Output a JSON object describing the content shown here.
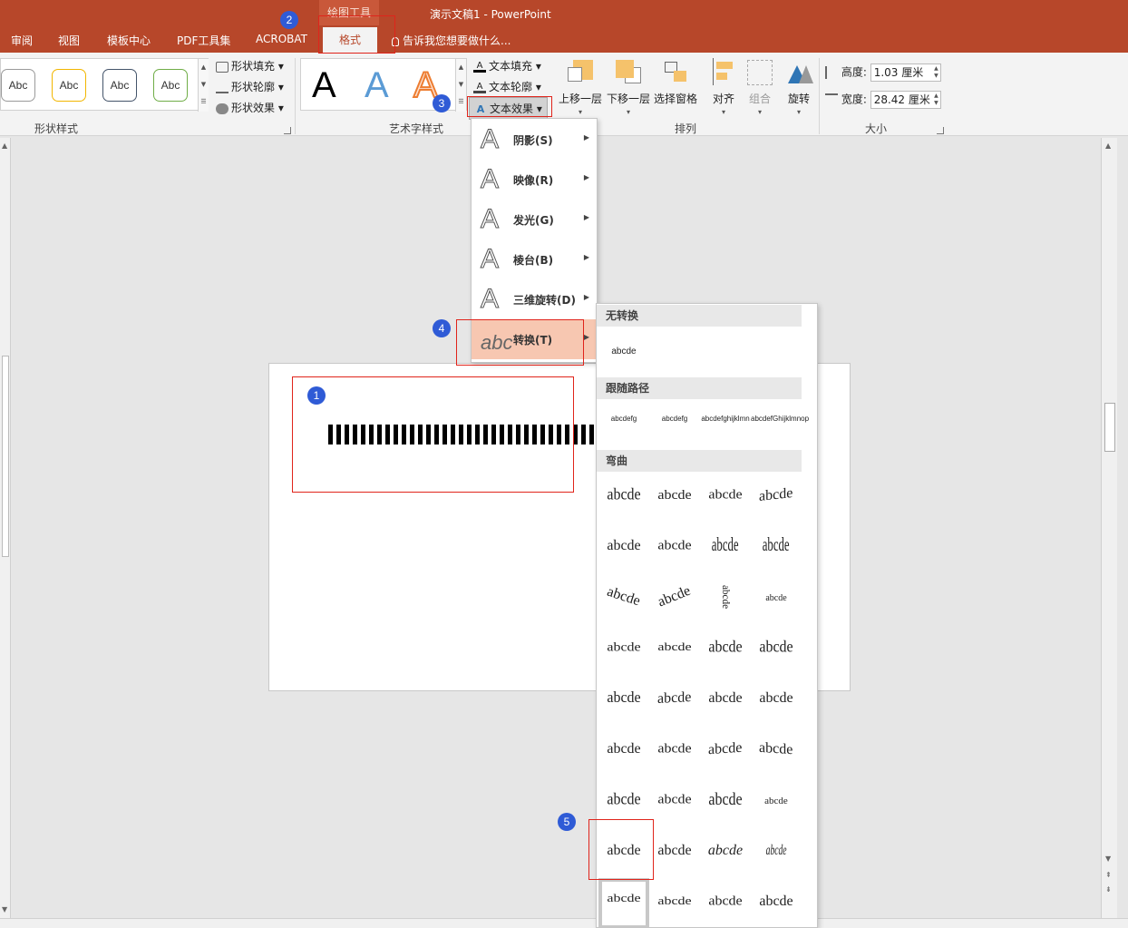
{
  "window": {
    "context_tab_group": "绘图工具",
    "title": "演示文稿1 - PowerPoint"
  },
  "tabs": [
    "审阅",
    "视图",
    "模板中心",
    "PDF工具集",
    "ACROBAT",
    "格式"
  ],
  "active_tab": "格式",
  "tell_me": "告诉我您想要做什么...",
  "ribbon": {
    "shape_styles": {
      "label": "形状样式",
      "swatches": [
        {
          "text": "Abc",
          "border": "#9a9a9a"
        },
        {
          "text": "Abc",
          "border": "#f2b600"
        },
        {
          "text": "Abc",
          "border": "#44546a"
        },
        {
          "text": "Abc",
          "border": "#70ad47"
        }
      ],
      "fill": "形状填充",
      "outline": "形状轮廓",
      "effects": "形状效果"
    },
    "wordart": {
      "label": "艺术字样式",
      "letters": [
        {
          "char": "A",
          "style": "black"
        },
        {
          "char": "A",
          "style": "blue-gradient"
        },
        {
          "char": "A",
          "style": "orange-outline"
        }
      ],
      "text_fill": "文本填充",
      "text_outline": "文本轮廓",
      "text_effects": "文本效果"
    },
    "arrange": {
      "label": "排列",
      "bring_forward": "上移一层",
      "send_backward": "下移一层",
      "selection_pane": "选择窗格",
      "align": "对齐",
      "group": "组合",
      "rotate": "旋转"
    },
    "size": {
      "label": "大小",
      "height_label": "高度:",
      "height_value": "1.03 厘米",
      "width_label": "宽度:",
      "width_value": "28.42 厘米"
    }
  },
  "effects_menu": [
    {
      "label": "阴影(S)",
      "has_submenu": true
    },
    {
      "label": "映像(R)",
      "has_submenu": true
    },
    {
      "label": "发光(G)",
      "has_submenu": true
    },
    {
      "label": "棱台(B)",
      "has_submenu": true
    },
    {
      "label": "三维旋转(D)",
      "has_submenu": true
    },
    {
      "label": "转换(T)",
      "has_submenu": true,
      "selected": true
    }
  ],
  "transform_panel": {
    "sections": {
      "no_transform": "无转换",
      "follow_path": "跟随路径",
      "warp": "弯曲"
    },
    "no_transform_sample": "abcde",
    "path_samples": [
      "abcdefg",
      "abcdefg",
      "abcdefghijklmn",
      "abcdefGhijklmnop"
    ],
    "warp_sample": "abcde",
    "warp_rows": 9,
    "warp_cols": 4,
    "selected_warp": {
      "row": 8,
      "col": 1
    }
  },
  "annotations": [
    "1",
    "2",
    "3",
    "4",
    "5"
  ],
  "colors": {
    "accent": "#b7472a",
    "highlight_box": "#e0241b",
    "badge": "#2f5bd6",
    "menu_selected": "#f7c7b1"
  }
}
